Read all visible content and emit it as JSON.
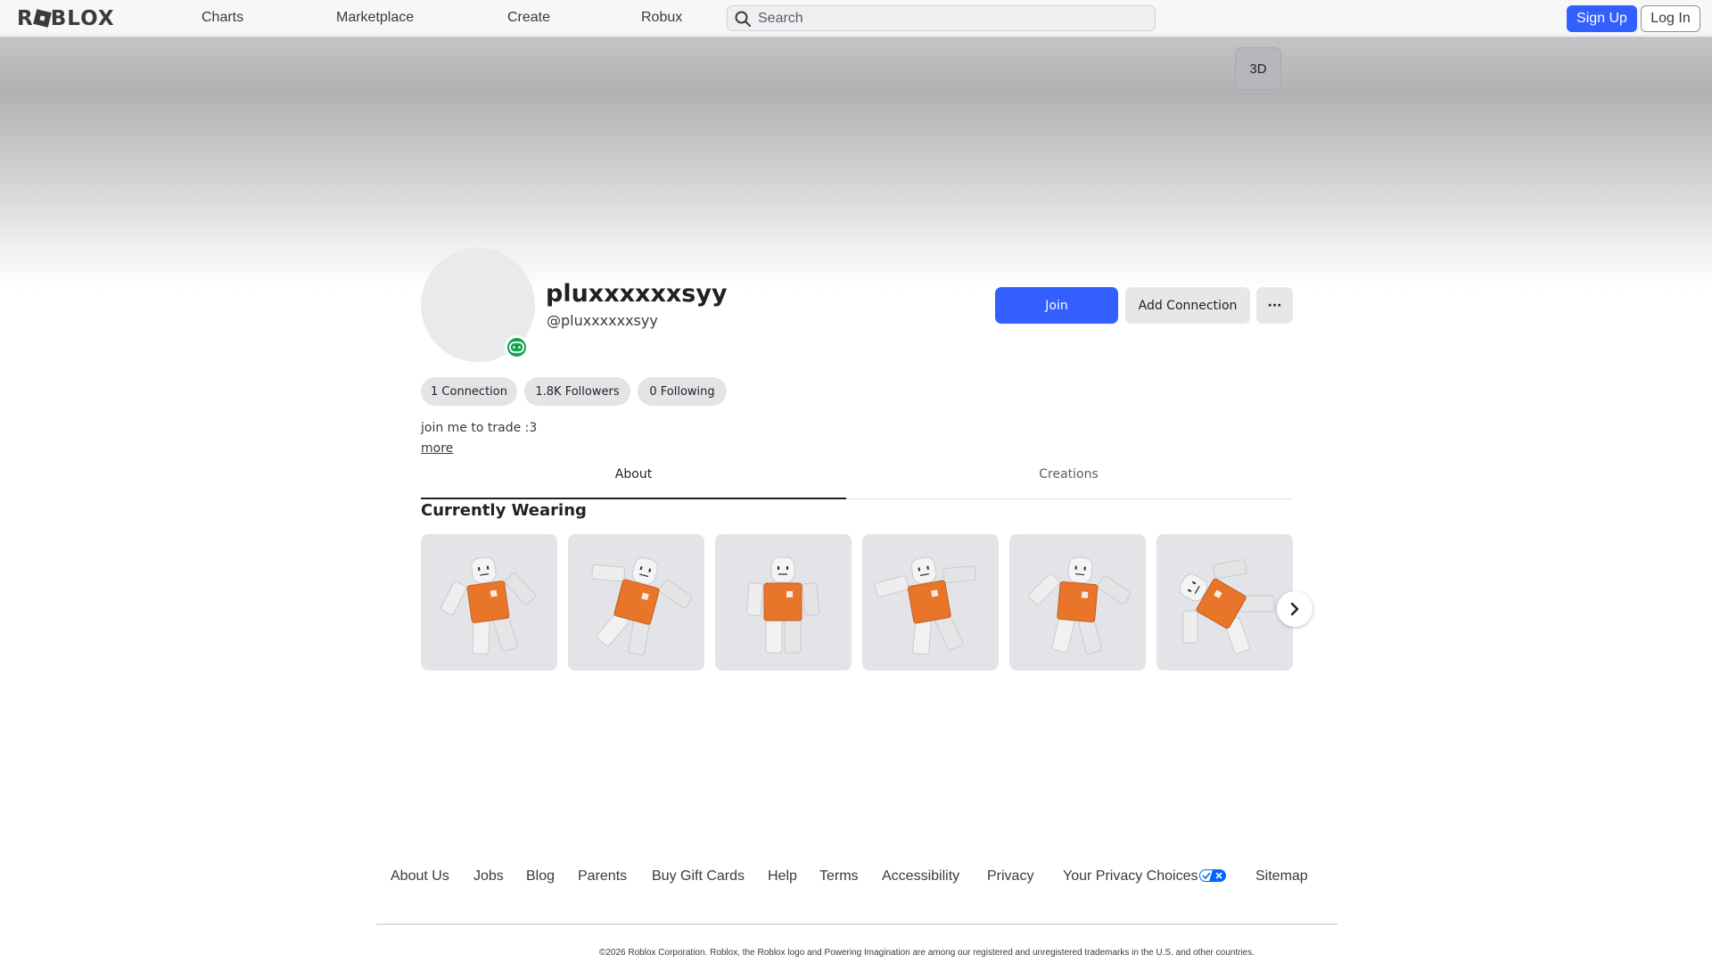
{
  "nav": {
    "logo": "ROBLOX",
    "links": [
      "Charts",
      "Marketplace",
      "Create",
      "Robux"
    ],
    "search_placeholder": "Search",
    "signup_label": "Sign Up",
    "login_label": "Log In"
  },
  "banner": {
    "view_3d_label": "3D"
  },
  "profile": {
    "display_name": "pluxxxxxxsyy",
    "username": "@pluxxxxxxsyy",
    "status_icon": "game-controller-icon",
    "status_color": "#11a54a",
    "join_label": "Join",
    "add_connection_label": "Add Connection",
    "more_label": "···",
    "stats": {
      "connections": "1 Connection",
      "followers": "1.8K Followers",
      "following": "0 Following"
    },
    "bio": "join me to trade :3",
    "more_link": "more"
  },
  "tabs": {
    "about": "About",
    "creations": "Creations",
    "active": "About"
  },
  "wearing": {
    "title": "Currently Wearing",
    "items": [
      {
        "name": "avatar-pose-1",
        "icon": "avatar-figure"
      },
      {
        "name": "avatar-pose-2",
        "icon": "avatar-figure"
      },
      {
        "name": "avatar-pose-3",
        "icon": "avatar-figure"
      },
      {
        "name": "avatar-pose-4",
        "icon": "avatar-figure"
      },
      {
        "name": "avatar-pose-5",
        "icon": "avatar-figure"
      },
      {
        "name": "avatar-pose-6",
        "icon": "avatar-figure"
      }
    ],
    "shirt_color": "#e8752a",
    "next_icon": "chevron-right-icon"
  },
  "footer": {
    "links": [
      "About Us",
      "Jobs",
      "Blog",
      "Parents",
      "Buy Gift Cards",
      "Help",
      "Terms",
      "Accessibility",
      "Privacy",
      "Your Privacy Choices",
      "Sitemap"
    ],
    "copyright": "©2026 Roblox Corporation. Roblox, the Roblox logo and Powering Imagination are among our registered and unregistered trademarks in the U.S. and other countries."
  },
  "colors": {
    "accent": "#335fff",
    "text": "#1f2126",
    "pill_bg": "#e3e4e6"
  }
}
